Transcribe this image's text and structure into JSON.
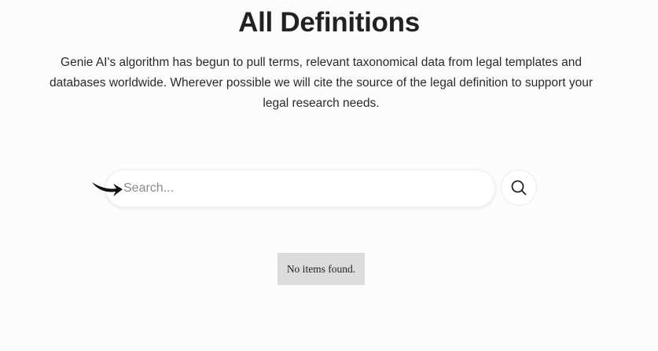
{
  "header": {
    "title": "All Definitions",
    "description": "Genie AI's algorithm has begun to pull terms, relevant taxonomical data from legal templates and databases worldwide. Wherever possible we will cite the source of the legal definition to support your legal research needs."
  },
  "search": {
    "placeholder": "Search...",
    "value": "",
    "button_icon": "search-icon",
    "pointer_icon": "arrow-icon"
  },
  "results": {
    "empty_message": "No items found."
  },
  "colors": {
    "background": "#fcfcfc",
    "empty_box": "#dcdcdc",
    "text": "#222222"
  }
}
